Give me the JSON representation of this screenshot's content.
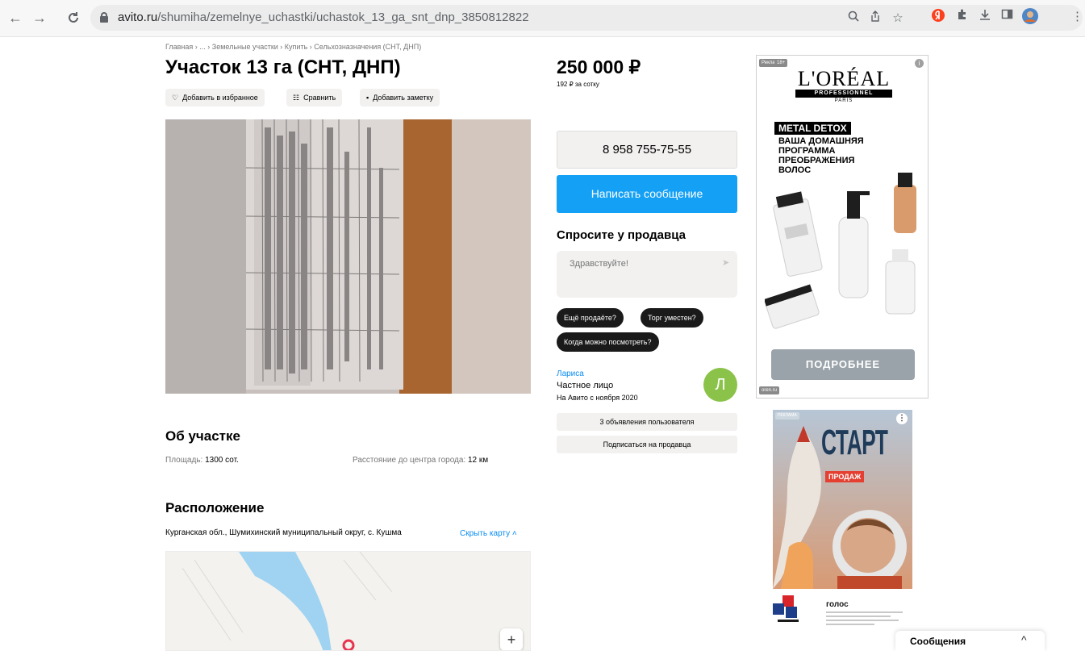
{
  "browser": {
    "url_host": "avito.ru",
    "url_path": "/shumiha/zemelnye_uchastki/uchastok_13_ga_snt_dnp_3850812822"
  },
  "breadcrumb": [
    "Главная",
    "...",
    "Земельные участки",
    "Купить",
    "Сельхозназначения (СНТ, ДНП)"
  ],
  "listing": {
    "title": "Участок 13 га (СНТ, ДНП)",
    "actions": {
      "favorite": "Добавить в избранное",
      "compare": "Сравнить",
      "note": "Добавить заметку"
    },
    "price": "250 000 ₽",
    "price_per_sotka": "192 ₽ за сотку"
  },
  "about": {
    "title": "Об участке",
    "area_label": "Площадь:",
    "area_value": "1300 сот.",
    "distance_label": "Расстояние до центра города:",
    "distance_value": "12 км"
  },
  "location": {
    "title": "Расположение",
    "address": "Курганская обл., Шумихинский муниципальный округ, с. Кушма",
    "hide_map": "Скрыть карту"
  },
  "contact": {
    "phone": "8 958 755-75-55",
    "write_message": "Написать сообщение",
    "ask_title": "Спросите у продавца",
    "ask_placeholder": "Здравствуйте!",
    "chips": [
      "Ещё продаёте?",
      "Торг уместен?",
      "Когда можно посмотреть?"
    ]
  },
  "seller": {
    "name": "Лариса",
    "type": "Частное лицо",
    "since": "На Авито с ноября 2020",
    "avatar_letter": "Л",
    "listings_button": "3 объявления пользователя",
    "subscribe_button": "Подписаться на продавца"
  },
  "ad1": {
    "badge": "Реклама",
    "age": "18+",
    "brand": "L'ORÉAL",
    "brand_line": "PROFESSIONNEL",
    "brand_city": "PARIS",
    "product": "METAL DETOX",
    "copy": [
      "ВАША ДОМАШНЯЯ",
      "ПРОГРАММА",
      "ПРЕОБРАЖЕНИЯ",
      "ВОЛОС"
    ],
    "cta": "ПОДРОБНЕЕ",
    "footer": "oren.ru"
  },
  "ad2": {
    "badge": "РЕКЛАМА",
    "headline": "СТАРТ",
    "sub": "ПРОДАЖ",
    "brand": "голос"
  },
  "messages": {
    "label": "Сообщения"
  },
  "colors": {
    "accent_blue": "#14a0f5",
    "avatar_green": "#8bc34a",
    "chip_dark": "#1a1a1a"
  }
}
